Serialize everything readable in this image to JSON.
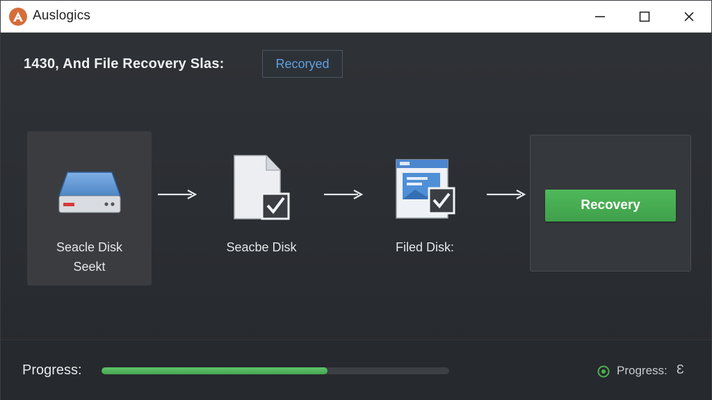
{
  "window": {
    "app_title": "Auslogics",
    "logo_letter": "A"
  },
  "header": {
    "label": "1430, And File Recovery Slas:",
    "badge": "Recoryed"
  },
  "steps": [
    {
      "label_line1": "Seacle Disk",
      "label_line2": "Seekt",
      "icon": "hard-drive-icon"
    },
    {
      "label_line1": "Seacbe Disk",
      "icon": "document-check-icon"
    },
    {
      "label_line1": "Filed Disk:",
      "icon": "image-file-check-icon"
    }
  ],
  "recovery": {
    "button_label": "Recovery"
  },
  "footer": {
    "progress_label": "Progress:",
    "progress_value": 0.65,
    "status_label": "Progress:",
    "status_extra": "Ɛ"
  },
  "colors": {
    "accent_green": "#4caf50",
    "badge_text": "#5ea2e2",
    "logo": "#d56d3a"
  }
}
